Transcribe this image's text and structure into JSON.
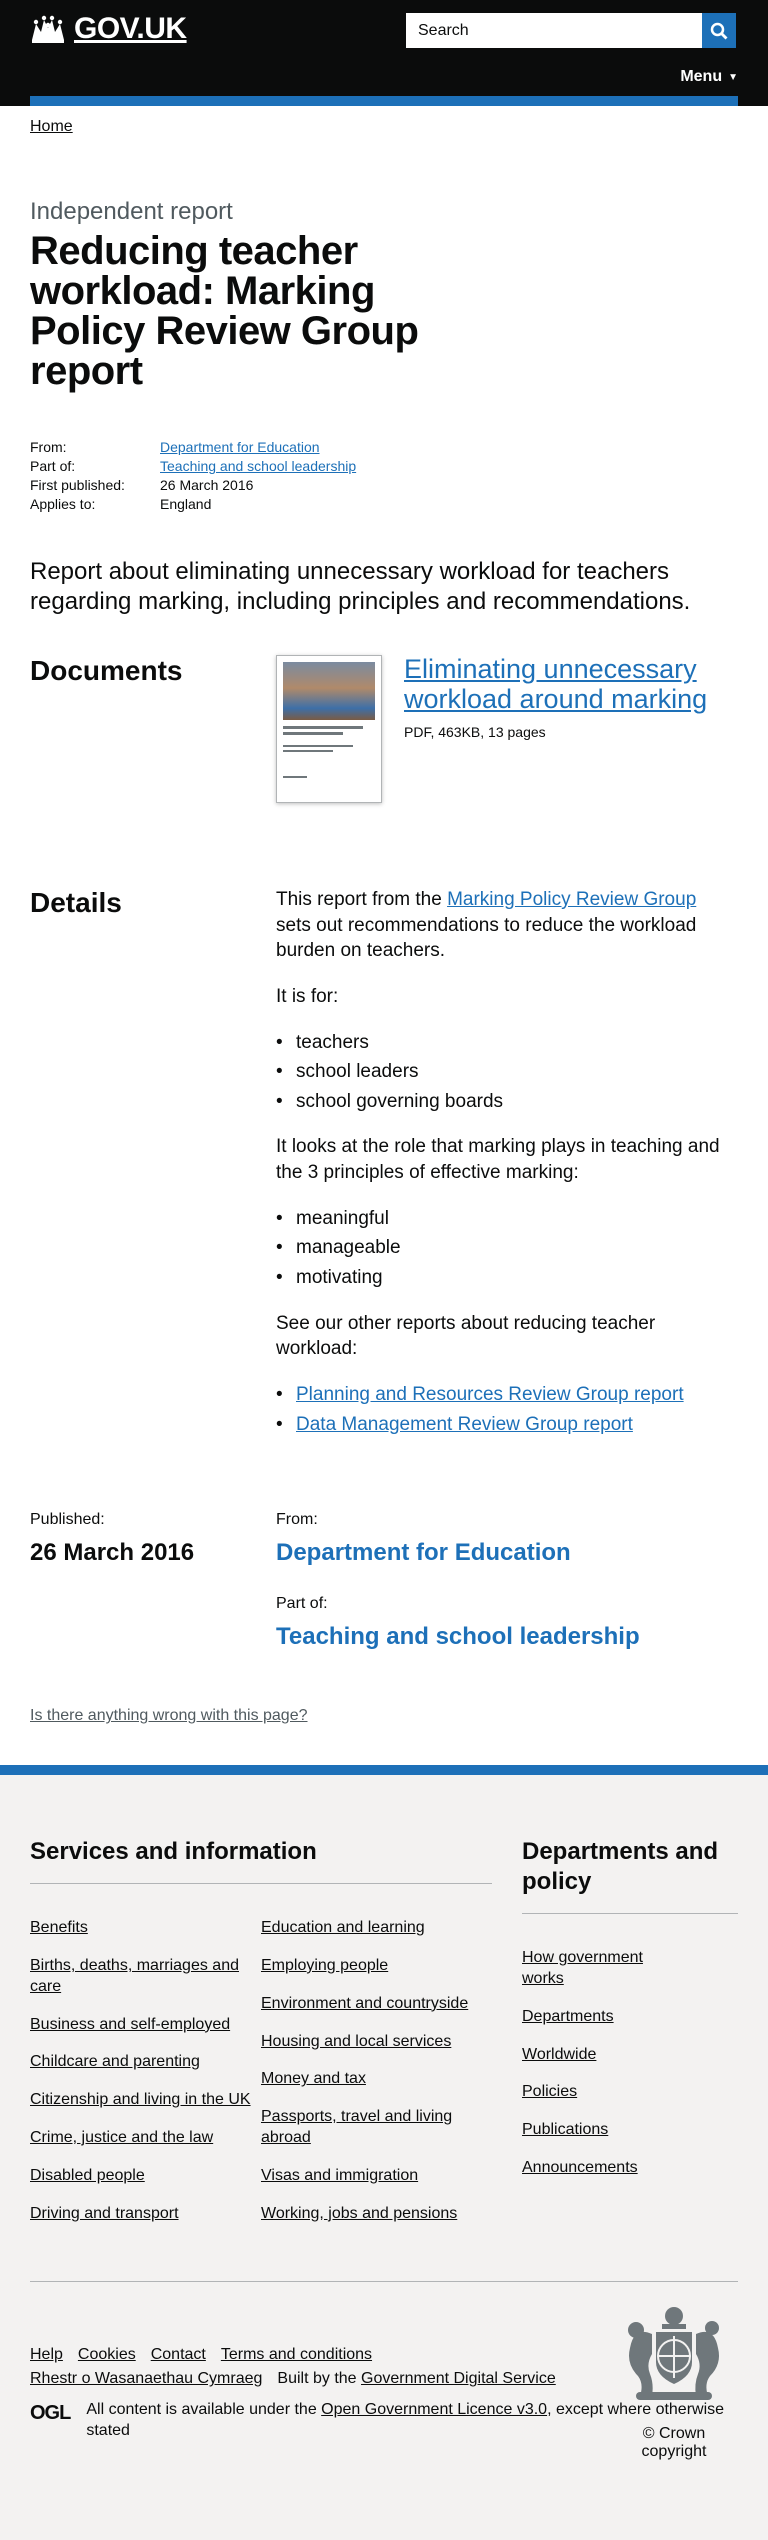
{
  "header": {
    "logo_text": "GOV.UK",
    "search_placeholder": "Search",
    "menu_label": "Menu"
  },
  "breadcrumb": {
    "home": "Home"
  },
  "page": {
    "caption": "Independent report",
    "title": "Reducing teacher workload: Marking Policy Review Group report",
    "meta": [
      {
        "key": "From:",
        "value": "Department for Education",
        "link": true
      },
      {
        "key": "Part of:",
        "value": "Teaching and school leadership",
        "link": true
      },
      {
        "key": "First published:",
        "value": "26 March 2016",
        "link": false
      },
      {
        "key": "Applies to:",
        "value": "England",
        "link": false
      }
    ],
    "lead": "Report about eliminating unnecessary workload for teachers regarding marking, including principles and recommendations."
  },
  "documents": {
    "heading": "Documents",
    "items": [
      {
        "title": "Eliminating unnecessary workload around marking",
        "meta": "PDF, 463KB, 13 pages"
      }
    ]
  },
  "details": {
    "heading": "Details",
    "p1_before": "This report from the ",
    "p1_link": "Marking Policy Review Group",
    "p1_after": " sets out recommendations to reduce the workload burden on teachers.",
    "p2": "It is for:",
    "audience": [
      "teachers",
      "school leaders",
      "school governing boards"
    ],
    "p3": "It looks at the role that marking plays in teaching and the 3 principles of effective marking:",
    "principles": [
      "meaningful",
      "manageable",
      "motivating"
    ],
    "p4": "See our other reports about reducing teacher workload:",
    "related": [
      "Planning and Resources Review Group report",
      "Data Management Review Group report"
    ]
  },
  "published": {
    "published_label": "Published:",
    "date": "26 March 2016",
    "from_label": "From:",
    "from_value": "Department for Education",
    "partof_label": "Part of:",
    "partof_value": "Teaching and school leadership"
  },
  "report_problem": "Is there anything wrong with this page?",
  "footer": {
    "services_heading": "Services and information",
    "services_col1": [
      "Benefits",
      "Births, deaths, marriages and care",
      "Business and self-employed",
      "Childcare and parenting",
      "Citizenship and living in the UK",
      "Crime, justice and the law",
      "Disabled people",
      "Driving and transport"
    ],
    "services_col2": [
      "Education and learning",
      "Employing people",
      "Environment and countryside",
      "Housing and local services",
      "Money and tax",
      "Passports, travel and living abroad",
      "Visas and immigration",
      "Working, jobs and pensions"
    ],
    "departments_heading": "Departments and policy",
    "departments": [
      "How government works",
      "Departments",
      "Worldwide",
      "Policies",
      "Publications",
      "Announcements"
    ],
    "links": [
      "Help",
      "Cookies",
      "Contact",
      "Terms and conditions"
    ],
    "welsh": "Rhestr o Wasanaethau Cymraeg",
    "built_by_prefix": "Built by the ",
    "built_by_link": "Government Digital Service",
    "ogl": "OGL",
    "licence_prefix": "All content is available under the ",
    "licence_link": "Open Government Licence v3.0",
    "licence_suffix": ", except where otherwise stated",
    "copyright": "© Crown copyright"
  }
}
